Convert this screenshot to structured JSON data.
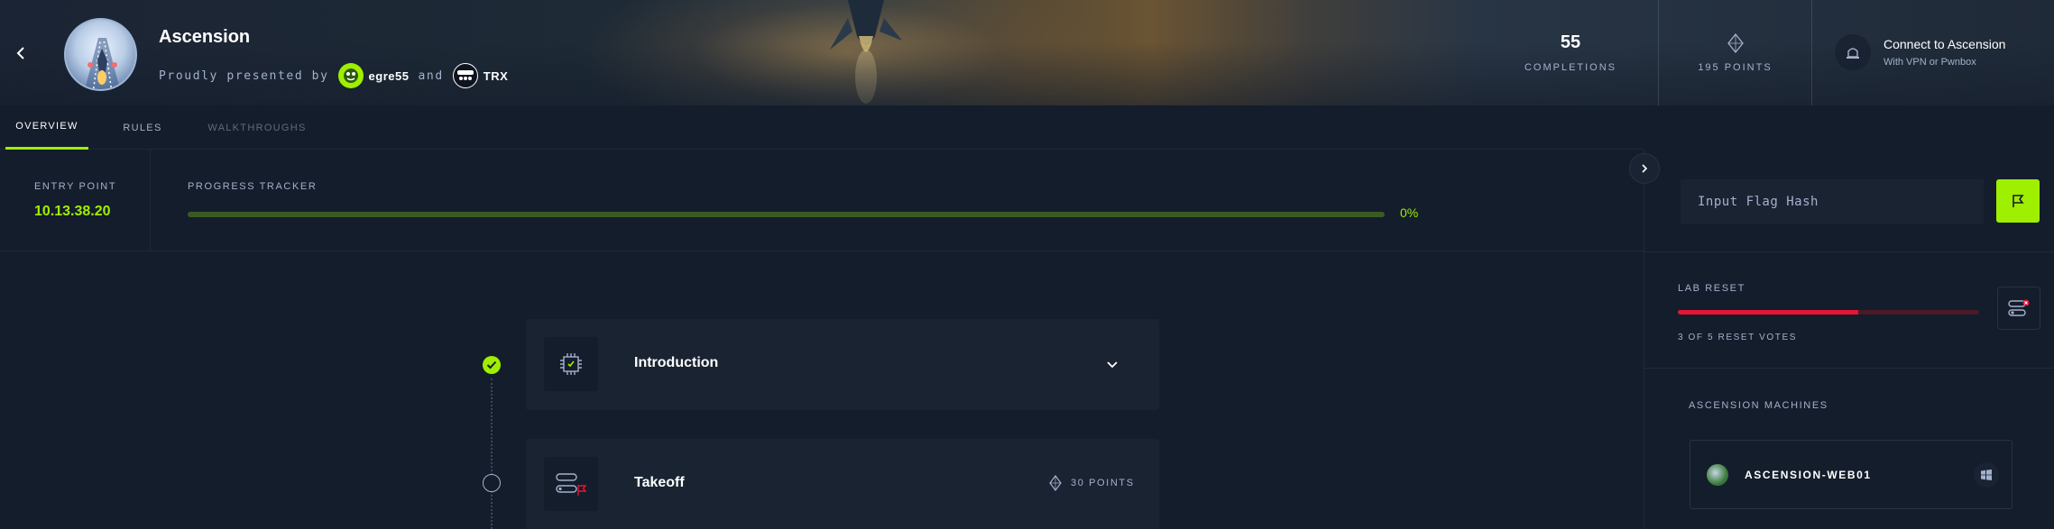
{
  "header": {
    "title": "Ascension",
    "presented_by": "Proudly presented by",
    "and": "and",
    "authors": [
      {
        "name": "egre55",
        "icon": "egre55-avatar"
      },
      {
        "name": "TRX",
        "icon": "trx-avatar"
      }
    ],
    "completions_value": "55",
    "completions_label": "COMPLETIONS",
    "points_label": "195 POINTS",
    "connect_title": "Connect to Ascension",
    "connect_sub": "With VPN or Pwnbox"
  },
  "tabs": [
    {
      "label": "OVERVIEW",
      "active": true
    },
    {
      "label": "RULES",
      "active": false
    },
    {
      "label": "WALKTHROUGHS",
      "active": false
    }
  ],
  "entry": {
    "label": "ENTRY POINT",
    "ip": "10.13.38.20"
  },
  "tracker": {
    "label": "PROGRESS TRACKER",
    "percent_text": "0%",
    "progress": 0
  },
  "flag": {
    "placeholder": "Input Flag Hash"
  },
  "lab_reset": {
    "label": "LAB RESET",
    "votes_text": "3 OF 5 RESET VOTES",
    "votes": 3,
    "votes_needed": 5
  },
  "machines": {
    "label": "ASCENSION MACHINES",
    "items": [
      {
        "name": "ASCENSION-WEB01",
        "os": "windows-icon"
      }
    ]
  },
  "steps": [
    {
      "title": "Introduction",
      "status": "completed",
      "icon": "chip-icon"
    },
    {
      "title": "Takeoff",
      "status": "open",
      "points": "30 POINTS",
      "icon": "flag-toggle-icon"
    }
  ],
  "colors": {
    "accent": "#9fef00",
    "danger": "#e51535",
    "background": "#141d2b",
    "card": "#1a2332"
  }
}
